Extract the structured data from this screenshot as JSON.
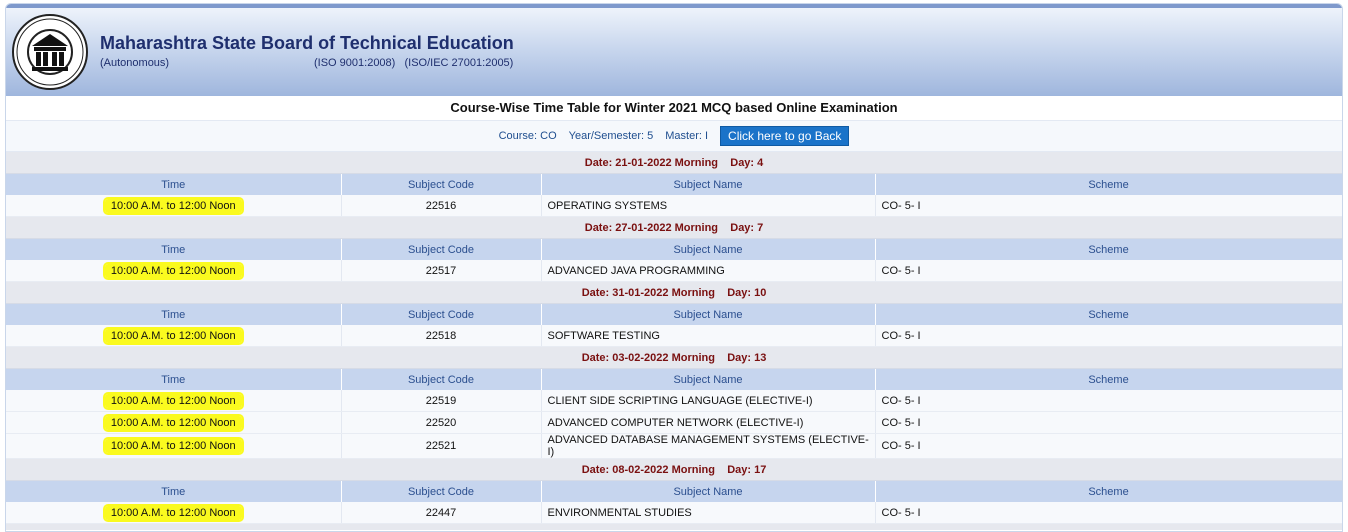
{
  "header": {
    "org_name": "Maharashtra State Board of Technical Education",
    "org_sub": "(Autonomous)",
    "org_iso": "(ISO 9001:2008)   (ISO/IEC 27001:2005)"
  },
  "page_title": "Course-Wise Time Table for Winter 2021 MCQ based Online Examination",
  "course_info": {
    "course": "Course: CO",
    "year_semester": "Year/Semester: 5",
    "master": "Master: I",
    "back_label": "Click here to go Back"
  },
  "columns": {
    "time": "Time",
    "code": "Subject Code",
    "name": "Subject Name",
    "scheme": "Scheme"
  },
  "sessions": [
    {
      "date": "Date: 21-01-2022 Morning",
      "day": "Day: 4",
      "rows": [
        {
          "time": "10:00 A.M. to 12:00 Noon",
          "code": "22516",
          "name": "OPERATING SYSTEMS",
          "scheme": "CO- 5- I"
        }
      ]
    },
    {
      "date": "Date: 27-01-2022 Morning",
      "day": "Day: 7",
      "rows": [
        {
          "time": "10:00 A.M. to 12:00 Noon",
          "code": "22517",
          "name": "ADVANCED JAVA PROGRAMMING",
          "scheme": "CO- 5- I"
        }
      ]
    },
    {
      "date": "Date: 31-01-2022 Morning",
      "day": "Day: 10",
      "rows": [
        {
          "time": "10:00 A.M. to 12:00 Noon",
          "code": "22518",
          "name": "SOFTWARE TESTING",
          "scheme": "CO- 5- I"
        }
      ]
    },
    {
      "date": "Date: 03-02-2022 Morning",
      "day": "Day: 13",
      "rows": [
        {
          "time": "10:00 A.M. to 12:00 Noon",
          "code": "22519",
          "name": "CLIENT SIDE SCRIPTING LANGUAGE (ELECTIVE-I)",
          "scheme": "CO- 5- I"
        },
        {
          "time": "10:00 A.M. to 12:00 Noon",
          "code": "22520",
          "name": "ADVANCED COMPUTER NETWORK (ELECTIVE-I)",
          "scheme": "CO- 5- I"
        },
        {
          "time": "10:00 A.M. to 12:00 Noon",
          "code": "22521",
          "name": "ADVANCED DATABASE MANAGEMENT SYSTEMS (ELECTIVE-I)",
          "scheme": "CO- 5- I"
        }
      ]
    },
    {
      "date": "Date: 08-02-2022 Morning",
      "day": "Day: 17",
      "rows": [
        {
          "time": "10:00 A.M. to 12:00 Noon",
          "code": "22447",
          "name": "ENVIRONMENTAL STUDIES",
          "scheme": "CO- 5- I"
        }
      ]
    }
  ]
}
